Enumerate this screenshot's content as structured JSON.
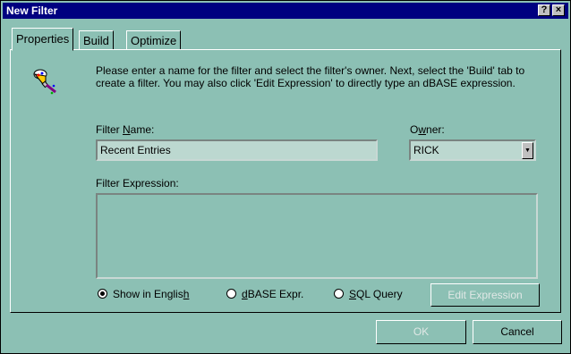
{
  "window": {
    "title": "New Filter",
    "help_button": "?",
    "close_button": "×"
  },
  "tabs": [
    {
      "label": "Properties",
      "active": true
    },
    {
      "label": "Build",
      "active": false
    },
    {
      "label": "Optimize",
      "active": false
    }
  ],
  "instructions": "Please enter a name for the filter and select the filter's owner.  Next, select the 'Build' tab to create a filter.  You may also click 'Edit Expression' to directly type an dBASE expression.",
  "filter_name": {
    "label_pre": "Filter ",
    "label_ul": "N",
    "label_post": "ame:",
    "value": "Recent Entries"
  },
  "owner": {
    "label_pre": "O",
    "label_ul": "w",
    "label_post": "ner:",
    "value": "RICK"
  },
  "filter_expression": {
    "label": "Filter Expression:",
    "value": ""
  },
  "mode_options": [
    {
      "pre": "Show in Englis",
      "ul": "h",
      "post": "",
      "selected": true
    },
    {
      "pre": "",
      "ul": "d",
      "post": "BASE Expr.",
      "selected": false
    },
    {
      "pre": "",
      "ul": "S",
      "post": "QL Query",
      "selected": false
    }
  ],
  "buttons": {
    "edit_expression": "Edit Expression",
    "ok": "OK",
    "cancel": "Cancel"
  },
  "icons": {
    "filter": "filter-funnel-icon"
  }
}
